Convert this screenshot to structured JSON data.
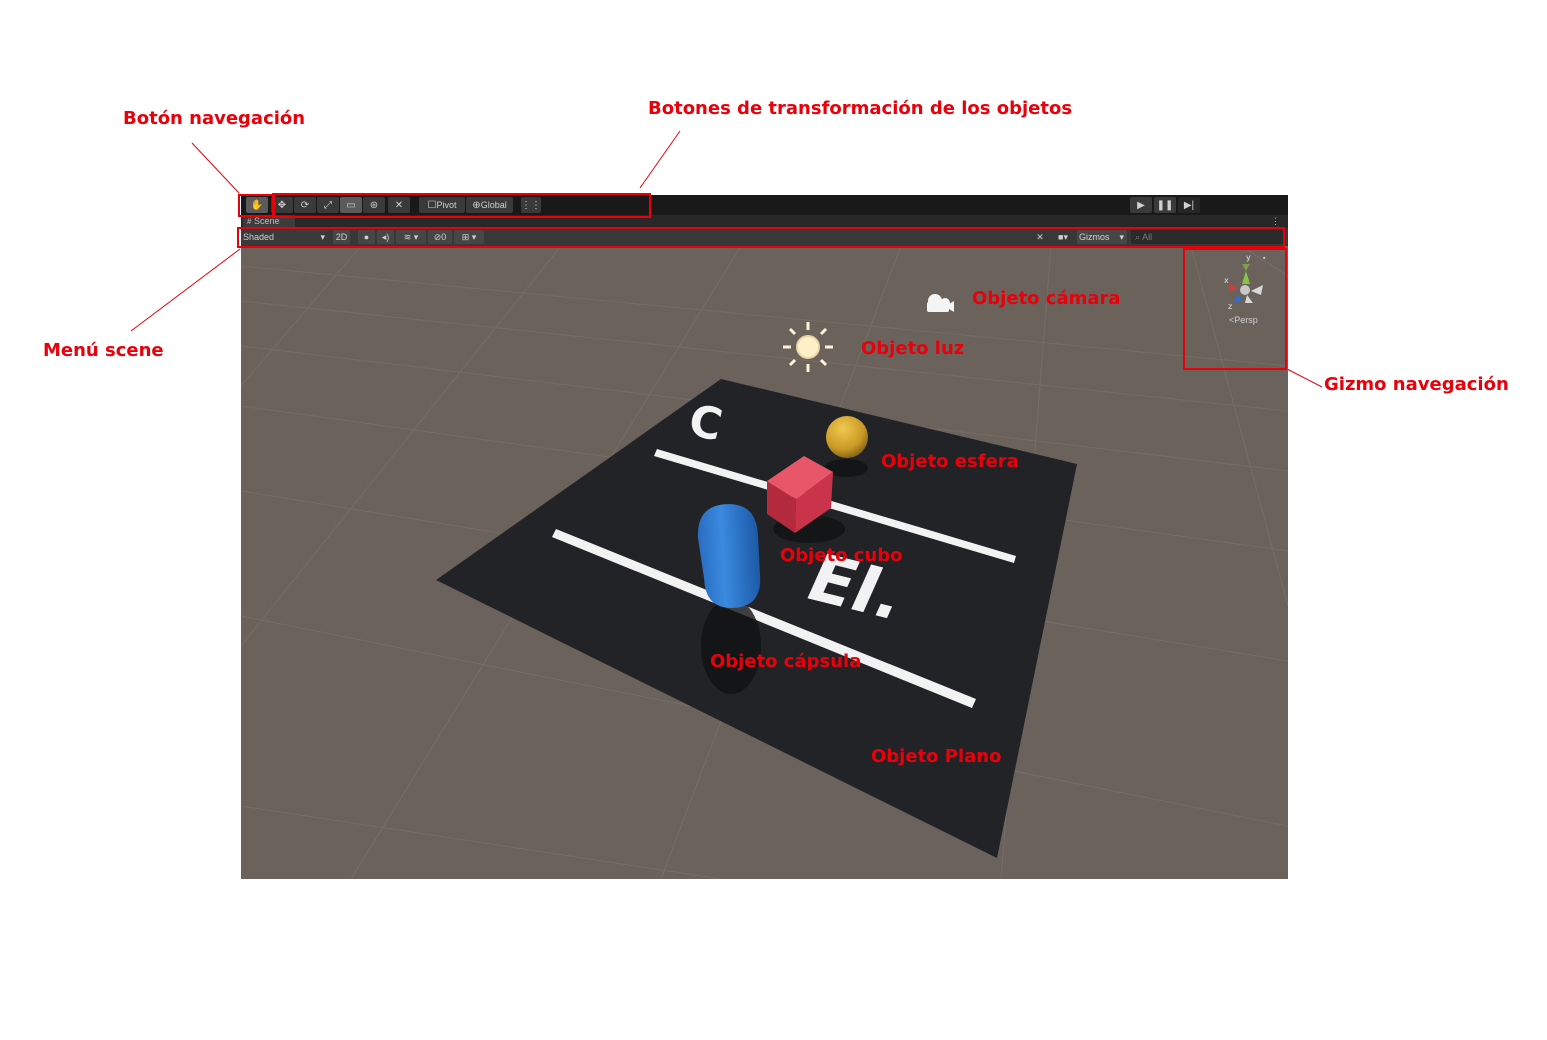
{
  "annotations": {
    "nav_button": "Botón navegación",
    "transform_buttons": "Botones de transformación de los objetos",
    "scene_menu": "Menú scene",
    "gizmo": "Gizmo navegación",
    "camera": "Objeto cámara",
    "light": "Objeto luz",
    "sphere": "Objeto esfera",
    "cube": "Objeto cubo",
    "capsule": "Objeto cápsula",
    "plane": "Objeto Plano"
  },
  "toolbar": {
    "pivot_label": "Pivot",
    "global_label": "Global",
    "tools": [
      "hand-icon",
      "move-icon",
      "rotate-icon",
      "scale-icon",
      "rect-tool-icon",
      "transform-icon",
      "custom-tool-icon"
    ],
    "active_tool": "rect-tool-icon"
  },
  "scene_tab": {
    "label": "Scene"
  },
  "scene_toolbar": {
    "shading_mode": "Shaded",
    "mode_2d": "2D",
    "hidden_count": "0",
    "gizmos_label": "Gizmos",
    "search_placeholder": "All"
  },
  "gizmo": {
    "x_label": "x",
    "y_label": "y",
    "z_label": "z",
    "projection_label": "Persp"
  },
  "plane_text": {
    "letter_c": "C",
    "letters_ei": "EI."
  },
  "colors": {
    "annotation": "#e8000b",
    "cube": "#d63848",
    "sphere": "#d4a52a",
    "capsule": "#2e7bd4",
    "plane": "#222327",
    "background": "#6b625c"
  }
}
